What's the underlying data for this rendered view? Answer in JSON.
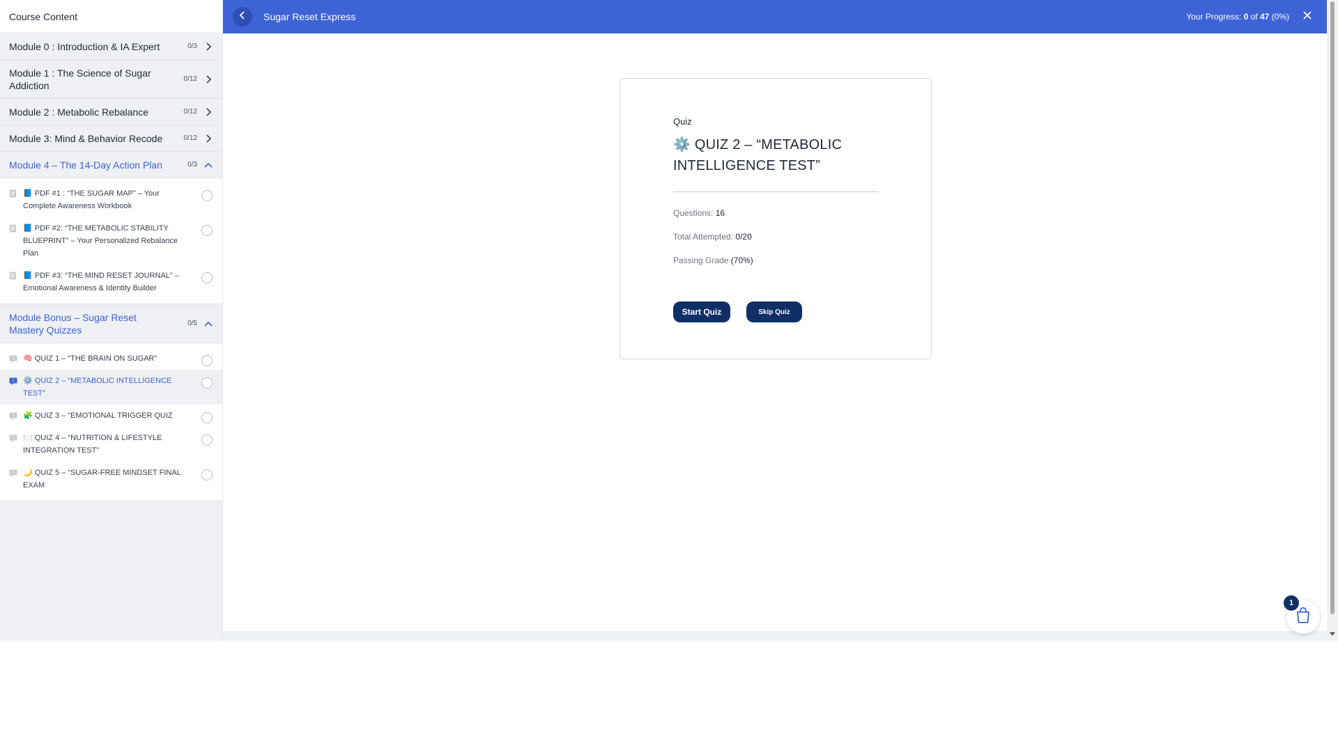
{
  "sidebar": {
    "header": "Course Content",
    "modules": [
      {
        "title": "Module 0 : Introduction & IA Expert",
        "count": "0/3"
      },
      {
        "title": "Module 1 : The Science of Sugar Addiction",
        "count": "0/12"
      },
      {
        "title": "Module 2 : Metabolic Rebalance",
        "count": "0/12"
      },
      {
        "title": "Module 3: Mind & Behavior Recode",
        "count": "0/12"
      },
      {
        "title": "Module 4 – The 14-Day Action Plan",
        "count": "0/3",
        "lessons": [
          {
            "title": "📘 PDF #1 : “THE SUGAR MAP” – Your Complete Awareness Workbook"
          },
          {
            "title": "📘 PDF #2: “THE METABOLIC STABILITY BLUEPRINT” – Your Personalized Rebalance Plan"
          },
          {
            "title": "📘 PDF #3: “THE MIND RESET JOURNAL” – Emotional Awareness & Identity Builder"
          }
        ]
      },
      {
        "title": "Module Bonus – Sugar Reset Mastery Quizzes",
        "count": "0/5",
        "lessons": [
          {
            "title": "🧠 QUIZ 1 – “THE BRAIN ON SUGAR”"
          },
          {
            "title": "⚙️ QUIZ 2 – “METABOLIC INTELLIGENCE TEST”"
          },
          {
            "title": "🧩 QUIZ 3 – “EMOTIONAL TRIGGER QUIZ"
          },
          {
            "title": "🍽️ QUIZ 4 – “NUTRITION & LIFESTYLE INTEGRATION TEST”"
          },
          {
            "title": "🌙 QUIZ 5 – “SUGAR-FREE MINDSET FINAL EXAM"
          }
        ]
      }
    ]
  },
  "topbar": {
    "course_title": "Sugar Reset Express",
    "progress_label": "Your Progress:",
    "progress_done": "0",
    "progress_of": "of",
    "progress_total": "47",
    "progress_pct": "(0%)"
  },
  "quiz": {
    "label": "Quiz",
    "title": "⚙️ QUIZ 2 – “METABOLIC INTELLIGENCE TEST”",
    "questions_label": "Questions:",
    "questions_value": "16",
    "attempted_label": "Total Attempted:",
    "attempted_value": "0/20",
    "passing_label": "Passing Grade",
    "passing_value": "(70%)",
    "start_label": "Start Quiz",
    "skip_label": "Skip Quiz"
  },
  "cart": {
    "badge": "1"
  },
  "colors": {
    "accent": "#3d63d6",
    "button": "#0f2f66"
  }
}
